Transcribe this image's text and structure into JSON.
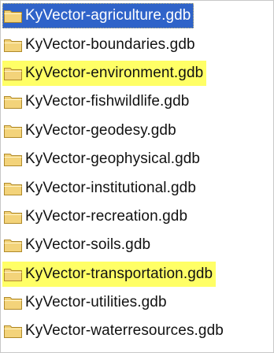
{
  "folders": [
    {
      "name": "KyVector-agriculture.gdb",
      "state": "selected"
    },
    {
      "name": "KyVector-boundaries.gdb",
      "state": "normal"
    },
    {
      "name": "KyVector-environment.gdb",
      "state": "highlighted"
    },
    {
      "name": "KyVector-fishwildlife.gdb",
      "state": "normal"
    },
    {
      "name": "KyVector-geodesy.gdb",
      "state": "normal"
    },
    {
      "name": "KyVector-geophysical.gdb",
      "state": "normal"
    },
    {
      "name": "KyVector-institutional.gdb",
      "state": "normal"
    },
    {
      "name": "KyVector-recreation.gdb",
      "state": "normal"
    },
    {
      "name": "KyVector-soils.gdb",
      "state": "normal"
    },
    {
      "name": "KyVector-transportation.gdb",
      "state": "highlighted"
    },
    {
      "name": "KyVector-utilities.gdb",
      "state": "normal"
    },
    {
      "name": "KyVector-waterresources.gdb",
      "state": "normal"
    }
  ],
  "icon": "folder-icon",
  "colors": {
    "selection": "#2f63c9",
    "highlight": "#ffff66",
    "folder_fill": "#f3d37a",
    "folder_stroke": "#b08a2a"
  }
}
